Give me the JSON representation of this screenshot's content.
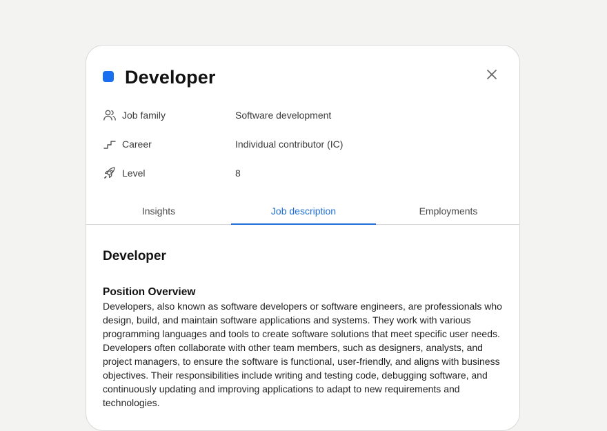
{
  "header": {
    "title": "Developer",
    "accent_color": "#1a6ef0",
    "close_icon": "close-icon"
  },
  "properties": [
    {
      "icon": "people-icon",
      "label": "Job family",
      "value": "Software development"
    },
    {
      "icon": "stairs-icon",
      "label": "Career",
      "value": "Individual contributor (IC)"
    },
    {
      "icon": "rocket-icon",
      "label": "Level",
      "value": "8"
    }
  ],
  "tabs": [
    {
      "label": "Insights",
      "active": false
    },
    {
      "label": "Job description",
      "active": true
    },
    {
      "label": "Employments",
      "active": false
    }
  ],
  "content": {
    "doc_title": "Developer",
    "section_heading": "Position Overview",
    "section_body": "Developers, also known as software developers or software engineers, are professionals who design, build, and maintain software applications and systems. They work with various programming languages and tools to create software solutions that meet specific user needs. Developers often collaborate with other team members, such as designers, analysts, and project managers, to ensure the software is functional, user-friendly, and aligns with business objectives. Their responsibilities include writing and testing code, debugging software, and continuously updating and improving applications to adapt to new requirements and technologies."
  },
  "colors": {
    "active_tab": "#1f6fd6",
    "background": "#f3f3f2"
  }
}
